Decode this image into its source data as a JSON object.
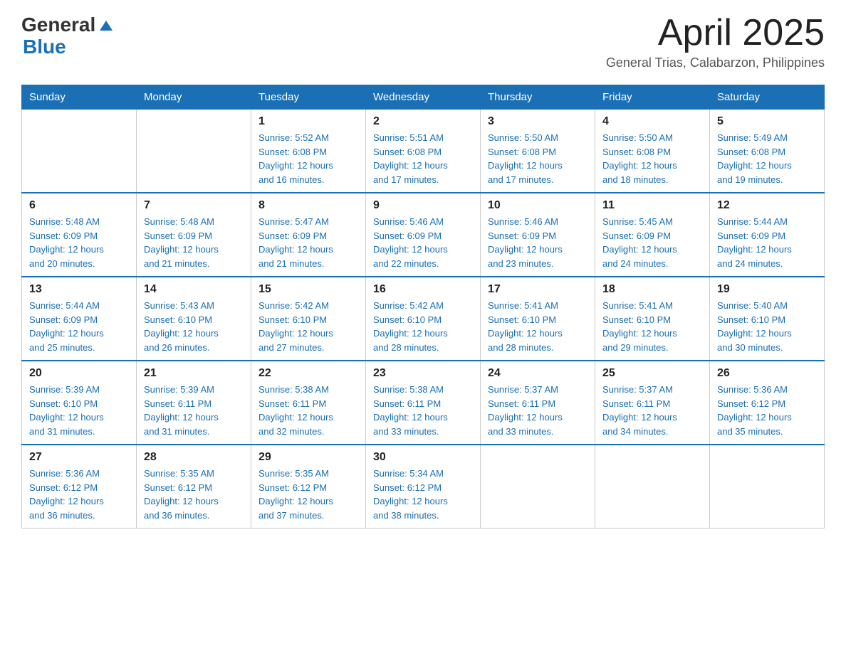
{
  "logo": {
    "text_general": "General",
    "text_blue": "Blue"
  },
  "header": {
    "month_title": "April 2025",
    "subtitle": "General Trias, Calabarzon, Philippines"
  },
  "weekdays": [
    "Sunday",
    "Monday",
    "Tuesday",
    "Wednesday",
    "Thursday",
    "Friday",
    "Saturday"
  ],
  "weeks": [
    [
      {
        "day": "",
        "info": ""
      },
      {
        "day": "",
        "info": ""
      },
      {
        "day": "1",
        "info": "Sunrise: 5:52 AM\nSunset: 6:08 PM\nDaylight: 12 hours\nand 16 minutes."
      },
      {
        "day": "2",
        "info": "Sunrise: 5:51 AM\nSunset: 6:08 PM\nDaylight: 12 hours\nand 17 minutes."
      },
      {
        "day": "3",
        "info": "Sunrise: 5:50 AM\nSunset: 6:08 PM\nDaylight: 12 hours\nand 17 minutes."
      },
      {
        "day": "4",
        "info": "Sunrise: 5:50 AM\nSunset: 6:08 PM\nDaylight: 12 hours\nand 18 minutes."
      },
      {
        "day": "5",
        "info": "Sunrise: 5:49 AM\nSunset: 6:08 PM\nDaylight: 12 hours\nand 19 minutes."
      }
    ],
    [
      {
        "day": "6",
        "info": "Sunrise: 5:48 AM\nSunset: 6:09 PM\nDaylight: 12 hours\nand 20 minutes."
      },
      {
        "day": "7",
        "info": "Sunrise: 5:48 AM\nSunset: 6:09 PM\nDaylight: 12 hours\nand 21 minutes."
      },
      {
        "day": "8",
        "info": "Sunrise: 5:47 AM\nSunset: 6:09 PM\nDaylight: 12 hours\nand 21 minutes."
      },
      {
        "day": "9",
        "info": "Sunrise: 5:46 AM\nSunset: 6:09 PM\nDaylight: 12 hours\nand 22 minutes."
      },
      {
        "day": "10",
        "info": "Sunrise: 5:46 AM\nSunset: 6:09 PM\nDaylight: 12 hours\nand 23 minutes."
      },
      {
        "day": "11",
        "info": "Sunrise: 5:45 AM\nSunset: 6:09 PM\nDaylight: 12 hours\nand 24 minutes."
      },
      {
        "day": "12",
        "info": "Sunrise: 5:44 AM\nSunset: 6:09 PM\nDaylight: 12 hours\nand 24 minutes."
      }
    ],
    [
      {
        "day": "13",
        "info": "Sunrise: 5:44 AM\nSunset: 6:09 PM\nDaylight: 12 hours\nand 25 minutes."
      },
      {
        "day": "14",
        "info": "Sunrise: 5:43 AM\nSunset: 6:10 PM\nDaylight: 12 hours\nand 26 minutes."
      },
      {
        "day": "15",
        "info": "Sunrise: 5:42 AM\nSunset: 6:10 PM\nDaylight: 12 hours\nand 27 minutes."
      },
      {
        "day": "16",
        "info": "Sunrise: 5:42 AM\nSunset: 6:10 PM\nDaylight: 12 hours\nand 28 minutes."
      },
      {
        "day": "17",
        "info": "Sunrise: 5:41 AM\nSunset: 6:10 PM\nDaylight: 12 hours\nand 28 minutes."
      },
      {
        "day": "18",
        "info": "Sunrise: 5:41 AM\nSunset: 6:10 PM\nDaylight: 12 hours\nand 29 minutes."
      },
      {
        "day": "19",
        "info": "Sunrise: 5:40 AM\nSunset: 6:10 PM\nDaylight: 12 hours\nand 30 minutes."
      }
    ],
    [
      {
        "day": "20",
        "info": "Sunrise: 5:39 AM\nSunset: 6:10 PM\nDaylight: 12 hours\nand 31 minutes."
      },
      {
        "day": "21",
        "info": "Sunrise: 5:39 AM\nSunset: 6:11 PM\nDaylight: 12 hours\nand 31 minutes."
      },
      {
        "day": "22",
        "info": "Sunrise: 5:38 AM\nSunset: 6:11 PM\nDaylight: 12 hours\nand 32 minutes."
      },
      {
        "day": "23",
        "info": "Sunrise: 5:38 AM\nSunset: 6:11 PM\nDaylight: 12 hours\nand 33 minutes."
      },
      {
        "day": "24",
        "info": "Sunrise: 5:37 AM\nSunset: 6:11 PM\nDaylight: 12 hours\nand 33 minutes."
      },
      {
        "day": "25",
        "info": "Sunrise: 5:37 AM\nSunset: 6:11 PM\nDaylight: 12 hours\nand 34 minutes."
      },
      {
        "day": "26",
        "info": "Sunrise: 5:36 AM\nSunset: 6:12 PM\nDaylight: 12 hours\nand 35 minutes."
      }
    ],
    [
      {
        "day": "27",
        "info": "Sunrise: 5:36 AM\nSunset: 6:12 PM\nDaylight: 12 hours\nand 36 minutes."
      },
      {
        "day": "28",
        "info": "Sunrise: 5:35 AM\nSunset: 6:12 PM\nDaylight: 12 hours\nand 36 minutes."
      },
      {
        "day": "29",
        "info": "Sunrise: 5:35 AM\nSunset: 6:12 PM\nDaylight: 12 hours\nand 37 minutes."
      },
      {
        "day": "30",
        "info": "Sunrise: 5:34 AM\nSunset: 6:12 PM\nDaylight: 12 hours\nand 38 minutes."
      },
      {
        "day": "",
        "info": ""
      },
      {
        "day": "",
        "info": ""
      },
      {
        "day": "",
        "info": ""
      }
    ]
  ]
}
